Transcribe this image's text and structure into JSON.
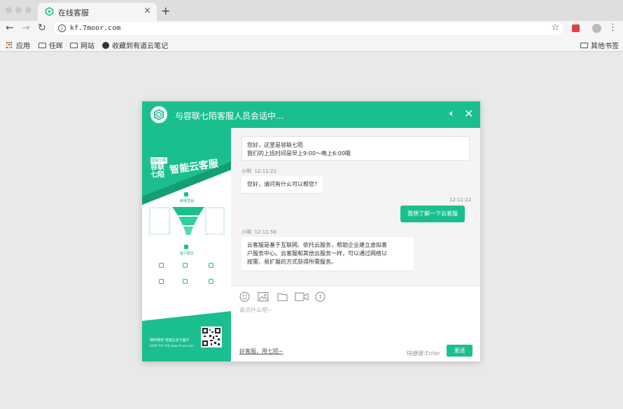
{
  "browser": {
    "tab_title": "在线客服",
    "new_tab": "+",
    "tab_close": "×",
    "url": "kf.7moor.com",
    "bookmarks": [
      {
        "label": "应用",
        "icon": "apps-grid-icon"
      },
      {
        "label": "任晖",
        "icon": "folder-icon"
      },
      {
        "label": "网站",
        "icon": "folder-icon"
      },
      {
        "label": "收藏到有道云笔记",
        "icon": "globe-icon"
      }
    ],
    "other_bookmarks": "其他书签"
  },
  "chat": {
    "header_title": "与容联七陌客服人员会话中...",
    "accent_color": "#1bbf8f",
    "welcome_line1": "您好，这里是容联七陌",
    "welcome_line2": "我们的上班时间是早上9:00～晚上6:00哦",
    "messages": [
      {
        "sender": "小明",
        "time": "12:11:22",
        "text": "您好，请问有什么可以帮您?",
        "direction": "in"
      },
      {
        "sender": "",
        "time": "12:11:22",
        "text": "我想了解一下云客服",
        "direction": "out"
      },
      {
        "sender": "小明",
        "time": "12:11:56",
        "lines": [
          "云客服是基于互联网、依托云服务，帮助企业建立虚拟客",
          "户服务中心。云客服和其他云服务一样，可以通过网络以",
          "按需、易扩展的方式获得所需服务。"
        ],
        "direction": "in"
      }
    ],
    "input_placeholder": "说点什么吧~",
    "footer_link": "好客服，用七陌~",
    "shortcut_hint": "快捷键:Enter",
    "send_label": "发送",
    "tools": [
      "emoji-icon",
      "image-icon",
      "file-icon",
      "video-icon",
      "help-icon"
    ]
  },
  "ad": {
    "badge": "容联七陌",
    "brand": "容联七陌",
    "headline": "智能云客服",
    "section1": "精准营销",
    "section2": "客户服务",
    "bottom_slogan": "随时随地  连接企业与客户",
    "phone": "4000-700-700  www.7moor.com"
  }
}
